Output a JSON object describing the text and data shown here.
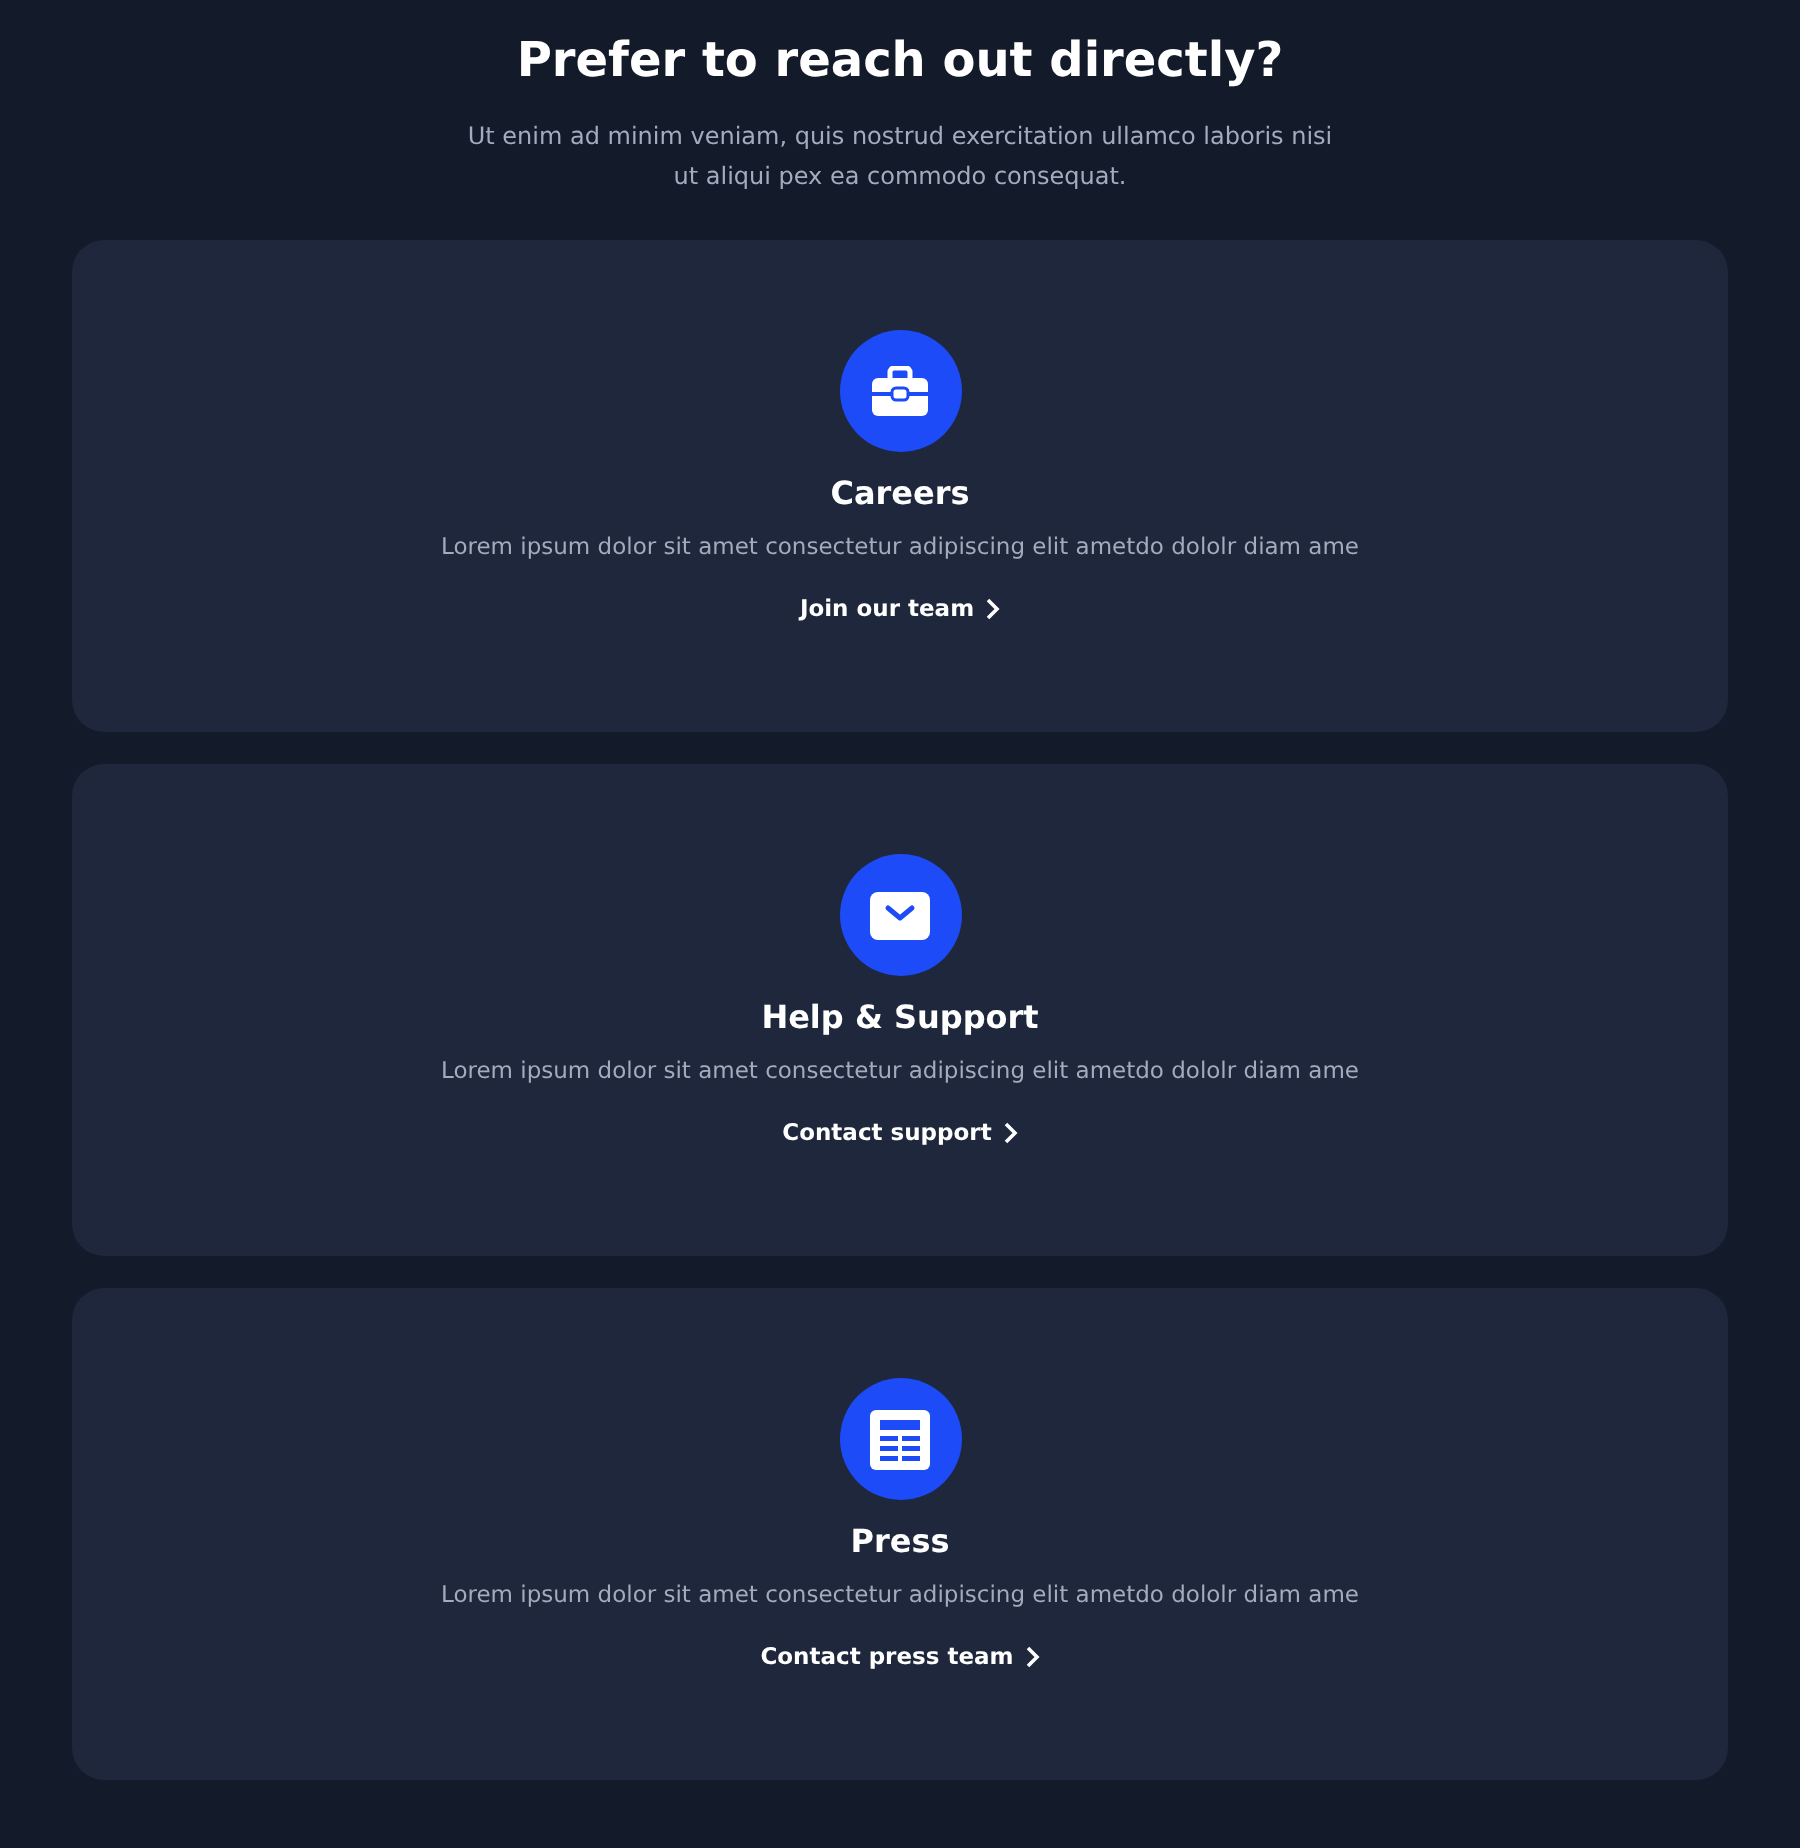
{
  "header": {
    "title": "Prefer to reach out directly?",
    "subtitle": "Ut enim ad minim veniam, quis nostrud exercitation ullamco laboris nisi ut aliqui pex ea commodo consequat."
  },
  "cards": [
    {
      "kind": "briefcase",
      "title": "Careers",
      "description": "Lorem ipsum dolor sit amet consectetur adipiscing elit ametdo dololr diam ame",
      "link": "Join our team"
    },
    {
      "kind": "mail",
      "title": "Help & Support",
      "description": "Lorem ipsum dolor sit amet consectetur adipiscing elit ametdo dololr diam ame",
      "link": "Contact support"
    },
    {
      "kind": "newspaper",
      "title": "Press",
      "description": "Lorem ipsum dolor sit amet consectetur adipiscing elit ametdo dololr diam ame",
      "link": "Contact press team"
    }
  ]
}
